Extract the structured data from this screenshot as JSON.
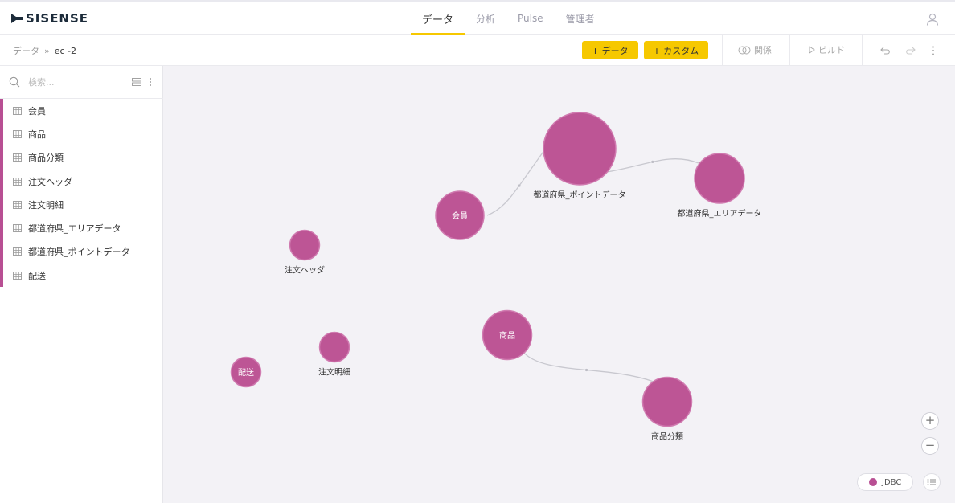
{
  "app": {
    "logo": "SISENSE"
  },
  "nav": {
    "tabs": [
      {
        "label": "データ",
        "active": true
      },
      {
        "label": "分析"
      },
      {
        "label": "Pulse"
      },
      {
        "label": "管理者"
      }
    ]
  },
  "toolbar": {
    "breadcrumb_root": "データ",
    "breadcrumb_sep": "»",
    "breadcrumb_current": "ec -2",
    "add_data_label": "データ",
    "add_custom_label": "カスタム",
    "relations_label": "関係",
    "build_label": "ビルド",
    "undo_icon": "undo-icon",
    "redo_icon": "redo-icon",
    "more_icon": "more-vert-icon"
  },
  "sidebar": {
    "search_placeholder": "検索...",
    "tables": [
      "会員",
      "商品",
      "商品分類",
      "注文ヘッダ",
      "注文明細",
      "都道府県_エリアデータ",
      "都道府県_ポイントデータ",
      "配送"
    ]
  },
  "graph": {
    "node_color": "#bd5595",
    "nodes": [
      {
        "id": "points",
        "label": "都道府県_ポイントデータ",
        "label_position": "below"
      },
      {
        "id": "area",
        "label": "都道府県_エリアデータ",
        "label_position": "below"
      },
      {
        "id": "member",
        "label": "会員",
        "label_position": "inside"
      },
      {
        "id": "header",
        "label": "注文ヘッダ",
        "label_position": "below"
      },
      {
        "id": "product",
        "label": "商品",
        "label_position": "inside"
      },
      {
        "id": "detail",
        "label": "注文明細",
        "label_position": "below"
      },
      {
        "id": "shipping",
        "label": "配送",
        "label_position": "inside"
      },
      {
        "id": "category",
        "label": "商品分類",
        "label_position": "below"
      }
    ],
    "links": [
      {
        "from": "member",
        "to": "points"
      },
      {
        "from": "points",
        "to": "area"
      },
      {
        "from": "product",
        "to": "category"
      }
    ]
  },
  "legend": {
    "label": "JDBC",
    "color": "#b84f93"
  },
  "zoom": {
    "in_label": "+",
    "out_label": "−"
  }
}
